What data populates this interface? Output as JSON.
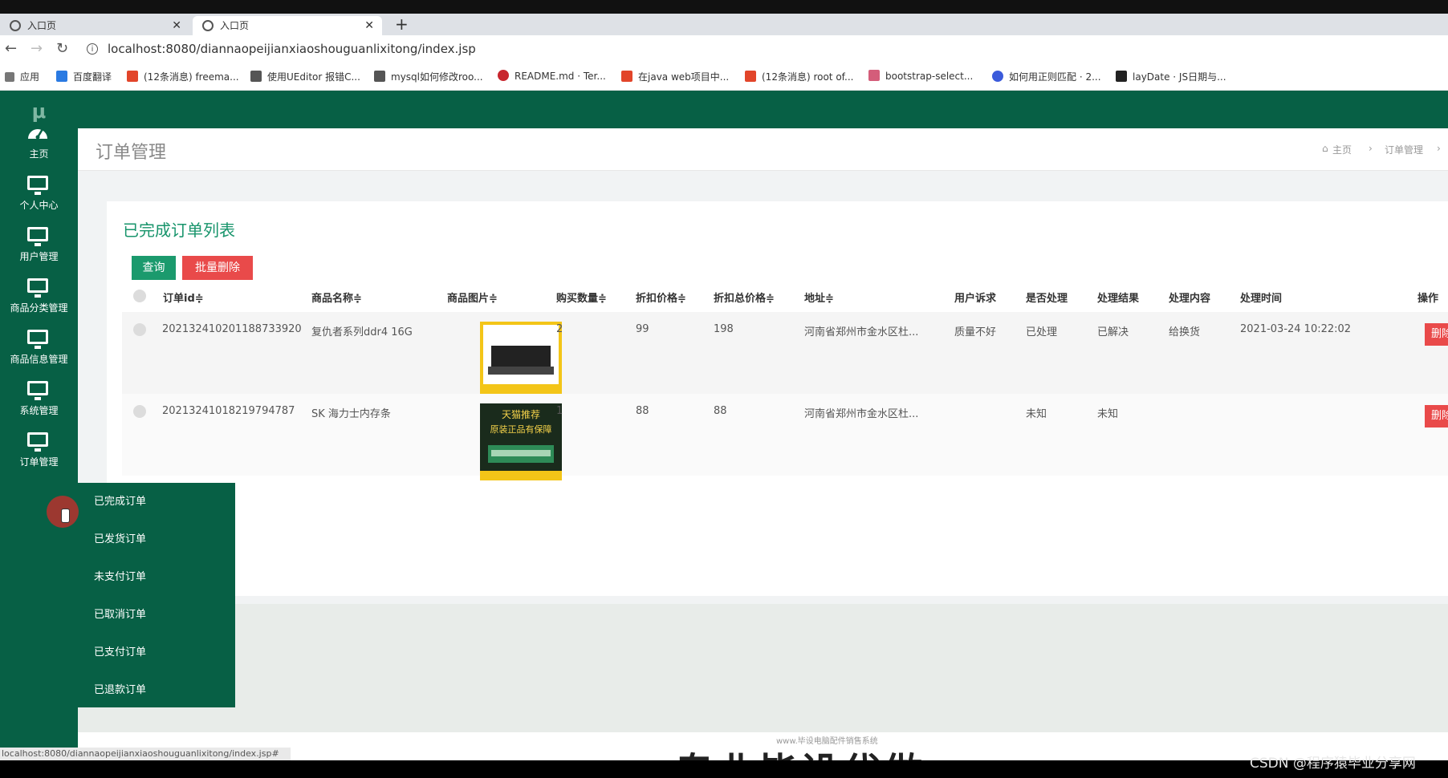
{
  "browser": {
    "tabs": [
      {
        "title": "入口页",
        "active": false
      },
      {
        "title": "入口页",
        "active": true
      }
    ],
    "new_tab_label": "+",
    "url": "localhost:8080/diannaopeijianxiaoshouguanlixitong/index.jsp",
    "bookmarks": [
      "应用",
      "百度翻译",
      "(12条消息) freema...",
      "使用UEditor 报错C...",
      "mysql如何修改roo...",
      "README.md · Ter...",
      "在java web项目中...",
      "(12条消息) root of...",
      "bootstrap-select...",
      "如何用正则匹配 · 2...",
      "layDate · JS日期与..."
    ]
  },
  "sidebar": {
    "logo": "μ",
    "items": [
      {
        "label": "主页",
        "icon": "dashboard-icon"
      },
      {
        "label": "个人中心",
        "icon": "monitor-icon"
      },
      {
        "label": "用户管理",
        "icon": "monitor-icon"
      },
      {
        "label": "商品分类管理",
        "icon": "monitor-icon"
      },
      {
        "label": "商品信息管理",
        "icon": "monitor-icon"
      },
      {
        "label": "系统管理",
        "icon": "monitor-icon"
      },
      {
        "label": "订单管理",
        "icon": "monitor-icon"
      }
    ],
    "submenu": [
      "已完成订单",
      "已发货订单",
      "未支付订单",
      "已取消订单",
      "已支付订单",
      "已退款订单"
    ]
  },
  "header": {
    "title": "订单管理",
    "breadcrumb": [
      "主页",
      "订单管理"
    ]
  },
  "panel": {
    "title": "已完成订单列表",
    "query_button": "查询",
    "batch_delete_button": "批量删除",
    "columns": [
      "订单id≑",
      "商品名称≑",
      "商品图片≑",
      "购买数量≑",
      "折扣价格≑",
      "折扣总价格≑",
      "地址≑",
      "用户诉求",
      "是否处理",
      "处理结果",
      "处理内容",
      "处理时间",
      "操作"
    ],
    "rows": [
      {
        "order_id": "202132410201188733920",
        "name": "复仇者系列ddr4 16G",
        "qty": "2",
        "price": "99",
        "total": "198",
        "address": "河南省郑州市金水区杜...",
        "demand": "质量不好",
        "processed": "已处理",
        "result": "已解决",
        "content": "给换货",
        "time": "2021-03-24 10:22:02",
        "action": "删除"
      },
      {
        "order_id": "20213241018219794787",
        "name": "SK 海力士内存条",
        "qty": "1",
        "price": "88",
        "total": "88",
        "address": "河南省郑州市金水区杜...",
        "demand": "",
        "processed": "未知",
        "result": "未知",
        "content": "",
        "time": "",
        "action": "删除"
      }
    ],
    "img2_text": [
      "天猫推荐",
      "原装正品有保障"
    ]
  },
  "footer": {
    "banner_big": "专业毕设代做",
    "banner_small": "www.毕设电脑配件销售系统",
    "status_url": "localhost:8080/diannaopeijianxiaoshouguanlixitong/index.jsp#",
    "watermark": "CSDN @程序猿毕业分享网"
  },
  "colors": {
    "sidebar": "#076045",
    "accent_green": "#1b9a6d",
    "danger_red": "#e94a4a"
  }
}
